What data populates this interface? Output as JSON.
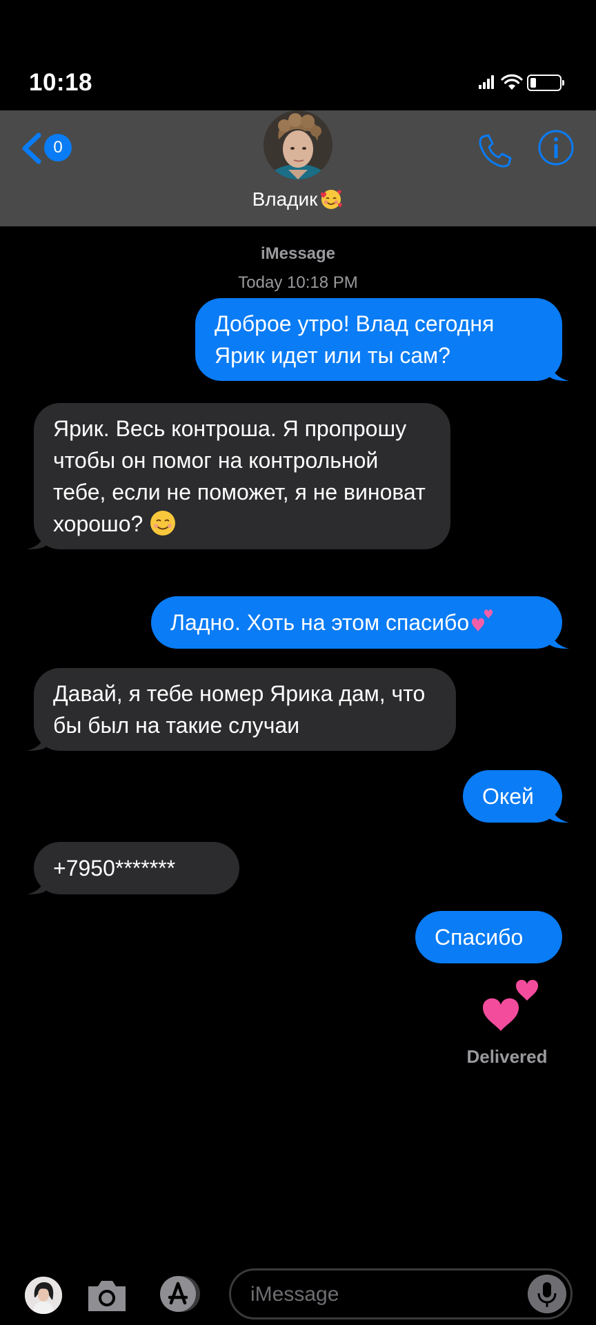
{
  "status_bar": {
    "time": "10:18",
    "battery_level": 0.15
  },
  "header": {
    "back_badge": "0",
    "contact_name": "Владик",
    "contact_emoji": "smiling-face-with-hearts"
  },
  "thread": {
    "service": "iMessage",
    "timestamp": "Today 10:18 PM",
    "messages": [
      {
        "direction": "out",
        "text": "Доброе утро! Влад сегодня Ярик идет или ты сам?"
      },
      {
        "direction": "in",
        "text": "Ярик. Весь контроша. Я пропрошу чтобы он помог на контрольной тебе, если не поможет, я не виноват хорошо?",
        "emoji": "smiling-face"
      },
      {
        "direction": "out",
        "text": "Ладно. Хоть на этом спасибо",
        "emoji": "two-hearts"
      },
      {
        "direction": "in",
        "text": "Давай, я тебе номер Ярика дам, что бы был на такие случаи"
      },
      {
        "direction": "out",
        "text": "Окей"
      },
      {
        "direction": "in",
        "text": "+7950*******"
      },
      {
        "direction": "out",
        "text": "Спасибо"
      },
      {
        "direction": "out",
        "emoji": "two-hearts"
      }
    ],
    "status": "Delivered"
  },
  "input": {
    "placeholder": "iMessage"
  },
  "colors": {
    "accent": "#0a7cf5",
    "header_bg": "#4a4a4a",
    "incoming_bubble": "#2c2c2e",
    "background": "#000000",
    "secondary_text": "#9a9a9e"
  },
  "icons": [
    "back-chevron-icon",
    "phone-icon",
    "info-icon",
    "camera-icon",
    "app-store-icon",
    "microphone-icon",
    "wifi-icon",
    "signal-icon",
    "battery-icon"
  ]
}
